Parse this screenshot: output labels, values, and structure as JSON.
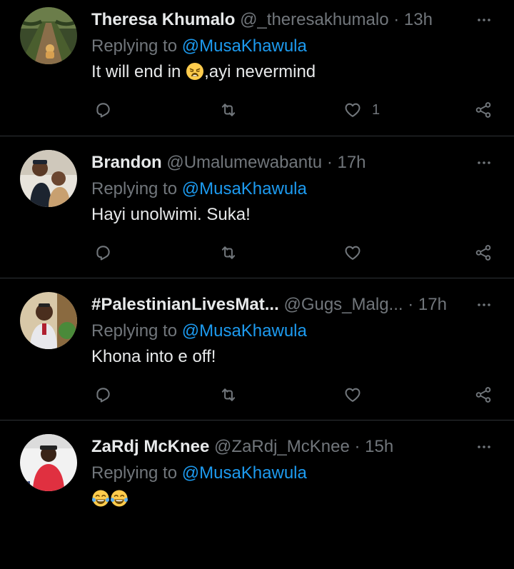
{
  "colors": {
    "background": "#000000",
    "divider": "#2f3336",
    "name": "#e7e9ea",
    "muted": "#71767b",
    "link": "#1d9bf0"
  },
  "tweets": [
    {
      "name": "Theresa Khumalo",
      "handle": "@_theresakhumalo",
      "separator": "·",
      "time": "13h",
      "replying_prefix": "Replying to",
      "mention": "@MusaKhawula",
      "text_before": "It will end in ",
      "text_after": ",ayi nevermind",
      "emoji": "weary-face-emoji",
      "like_count": "1",
      "icons": [
        "reply-icon",
        "retweet-icon",
        "like-icon",
        "share-icon",
        "more-icon"
      ]
    },
    {
      "name": "Brandon",
      "handle": "@Umalumewabantu",
      "separator": "·",
      "time": "17h",
      "replying_prefix": "Replying to",
      "mention": "@MusaKhawula",
      "text": "Hayi unolwimi. Suka!",
      "like_count": "",
      "icons": [
        "reply-icon",
        "retweet-icon",
        "like-icon",
        "share-icon",
        "more-icon"
      ]
    },
    {
      "name": "#PalestinianLivesMat...",
      "handle": "@Gugs_Malg...",
      "separator": "·",
      "time": "17h",
      "replying_prefix": "Replying to",
      "mention": "@MusaKhawula",
      "text": "Khona into e off!",
      "like_count": "",
      "icons": [
        "reply-icon",
        "retweet-icon",
        "like-icon",
        "share-icon",
        "more-icon"
      ]
    },
    {
      "name": "ZaRdj McKnee",
      "handle": "@ZaRdj_McKnee",
      "separator": "·",
      "time": "15h",
      "replying_prefix": "Replying to",
      "mention": "@MusaKhawula",
      "emoji": "tears-of-joy-emoji",
      "icons": [
        "more-icon"
      ]
    }
  ]
}
